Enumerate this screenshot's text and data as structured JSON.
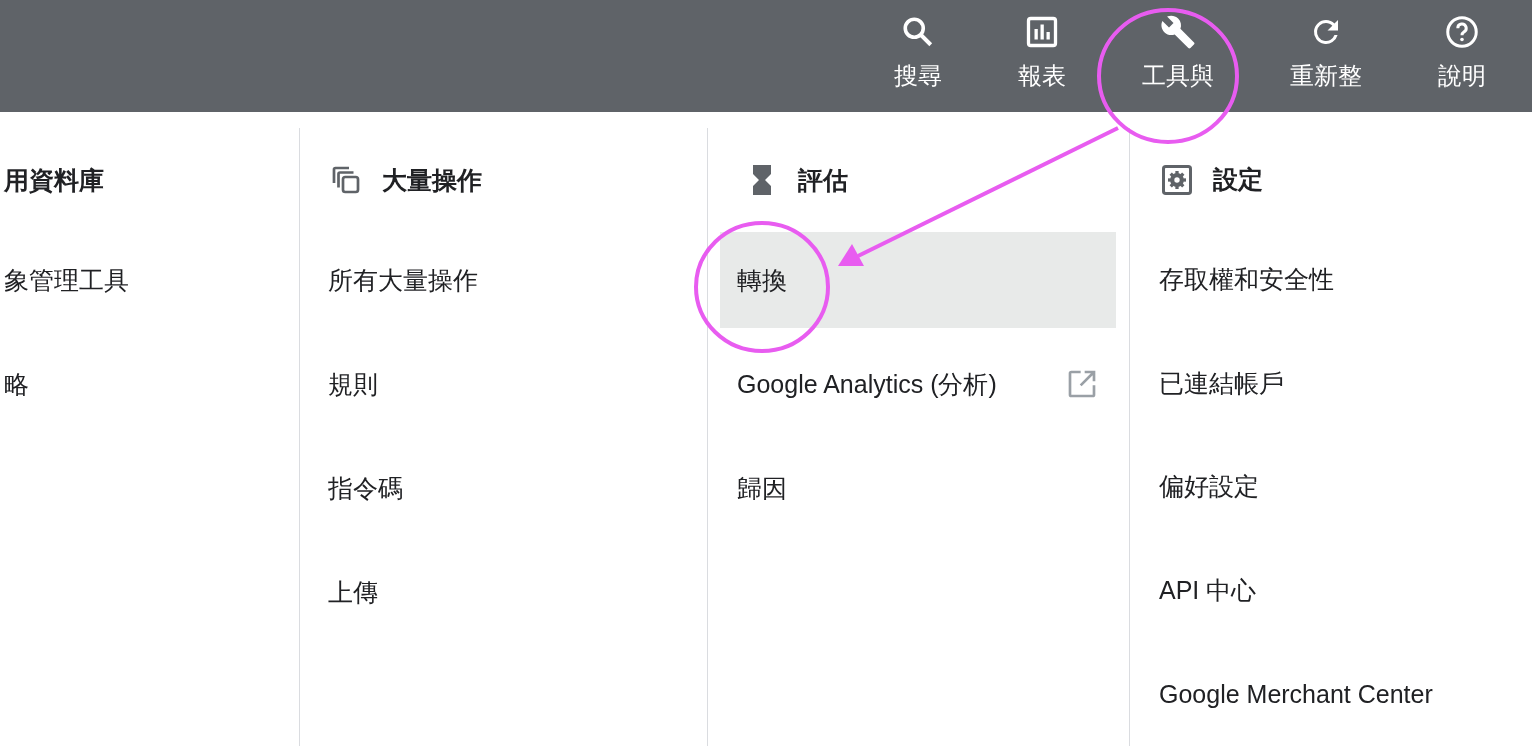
{
  "top_bar": {
    "items": [
      {
        "label": "搜尋"
      },
      {
        "label": "報表"
      },
      {
        "label": "工具與"
      },
      {
        "label": "重新整"
      },
      {
        "label": "說明"
      }
    ]
  },
  "columns": [
    {
      "header": {
        "title": "用資料庫"
      },
      "items": [
        {
          "label": "象管理工具",
          "selected": false
        },
        {
          "label": "略",
          "selected": false
        }
      ]
    },
    {
      "header": {
        "title": "大量操作"
      },
      "items": [
        {
          "label": "所有大量操作",
          "selected": false
        },
        {
          "label": "規則",
          "selected": false
        },
        {
          "label": "指令碼",
          "selected": false
        },
        {
          "label": "上傳",
          "selected": false
        }
      ]
    },
    {
      "header": {
        "title": "評估"
      },
      "items": [
        {
          "label": "轉換",
          "selected": true
        },
        {
          "label": "Google Analytics (分析)",
          "selected": false,
          "external": true
        },
        {
          "label": "歸因",
          "selected": false
        }
      ]
    },
    {
      "header": {
        "title": "設定"
      },
      "items": [
        {
          "label": "存取權和安全性",
          "selected": false
        },
        {
          "label": "已連結帳戶",
          "selected": false
        },
        {
          "label": "偏好設定",
          "selected": false
        },
        {
          "label": "API 中心",
          "selected": false
        },
        {
          "label": "Google Merchant Center",
          "selected": false
        }
      ]
    }
  ]
}
